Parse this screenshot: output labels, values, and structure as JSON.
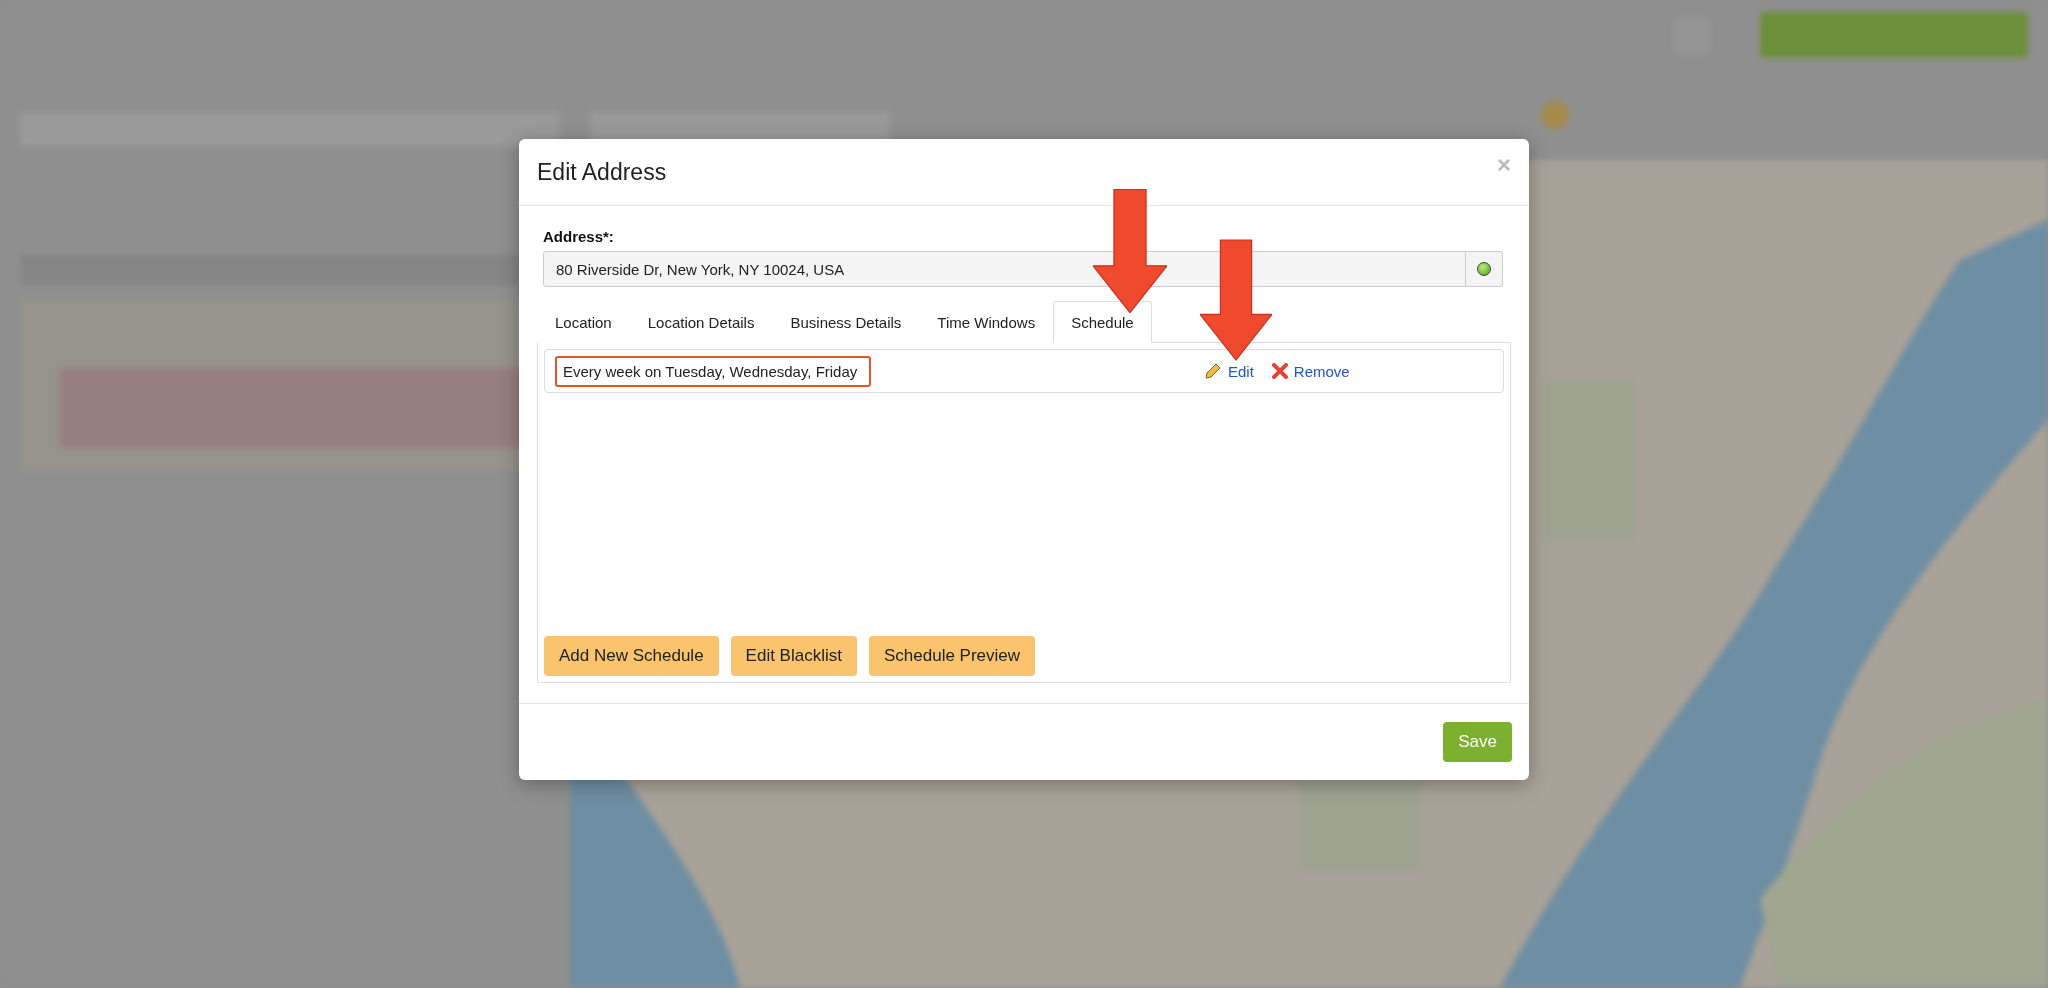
{
  "dialog": {
    "title": "Edit Address",
    "close": "×",
    "address": {
      "label": "Address*:",
      "value": "80 Riverside Dr, New York, NY 10024, USA"
    },
    "tabs": [
      {
        "label": "Location",
        "selected": false
      },
      {
        "label": "Location Details",
        "selected": false
      },
      {
        "label": "Business Details",
        "selected": false
      },
      {
        "label": "Time Windows",
        "selected": false
      },
      {
        "label": "Schedule",
        "selected": true
      }
    ],
    "schedules": [
      {
        "text": "Every week on Tuesday, Wednesday, Friday",
        "highlighted": true,
        "edit": "Edit",
        "remove": "Remove"
      }
    ],
    "actions": [
      "Add New Schedule",
      "Edit Blacklist",
      "Schedule Preview"
    ],
    "save": "Save"
  }
}
